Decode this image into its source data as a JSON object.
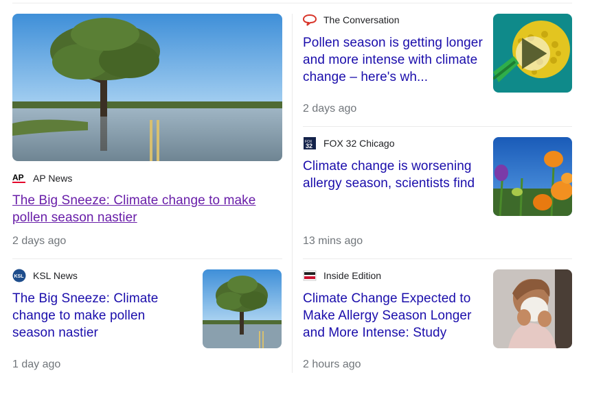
{
  "colors": {
    "link": "#1a0dab",
    "visited": "#681da8",
    "meta": "#70757a",
    "divider": "#ebebeb"
  },
  "articles": [
    {
      "source": "AP News",
      "logo_icon": "ap-logo-icon",
      "headline": "The Big Sneeze: Climate change to make pollen season nastier",
      "time": "2 days ago",
      "image": "flooded-tree-landscape"
    },
    {
      "source": "The Conversation",
      "logo_icon": "speech-bubble-icon",
      "headline": "Pollen season is getting longer and more intense with climate change – here's wh...",
      "time": "2 days ago",
      "image": "pollen-grain-video",
      "has_video": true
    },
    {
      "source": "FOX 32 Chicago",
      "logo_icon": "fox32-logo-icon",
      "headline": "Climate change is worsening allergy season, scientists find",
      "time": "13 mins ago",
      "image": "orange-flowers"
    },
    {
      "source": "KSL News",
      "logo_icon": "ksl-logo-icon",
      "headline": "The Big Sneeze: Climate change to make pollen season nastier",
      "time": "1 day ago",
      "image": "flooded-tree-landscape"
    },
    {
      "source": "Inside Edition",
      "logo_icon": "inside-edition-logo-icon",
      "headline": "Climate Change Expected to Make Allergy Season Longer and More Intense: Study",
      "time": "2 hours ago",
      "image": "woman-sneezing"
    }
  ]
}
